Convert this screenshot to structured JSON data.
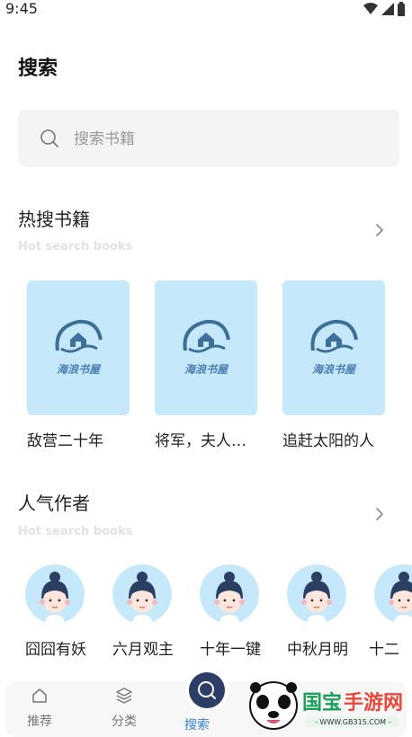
{
  "status": {
    "time": "9:45"
  },
  "page": {
    "title": "搜索"
  },
  "search": {
    "placeholder": "搜索书籍"
  },
  "hot_books": {
    "title": "热搜书籍",
    "subtitle": "Hot search books",
    "cover_logo_text": "海浪书屋",
    "books": [
      {
        "title": "敌营二十年"
      },
      {
        "title": "将军，夫人…"
      },
      {
        "title": "追赶太阳的人"
      }
    ]
  },
  "popular_authors": {
    "title": "人气作者",
    "subtitle": "Hot search books",
    "authors": [
      {
        "name": "囧囧有妖"
      },
      {
        "name": "六月观主"
      },
      {
        "name": "十年一键"
      },
      {
        "name": "中秋月明"
      },
      {
        "name": "十二"
      }
    ]
  },
  "tabs": [
    {
      "label": "推荐",
      "icon": "home-icon",
      "active": false
    },
    {
      "label": "分类",
      "icon": "layers-icon",
      "active": false
    },
    {
      "label": "搜索",
      "icon": "search-icon",
      "active": true
    }
  ],
  "watermark": {
    "brand": "国宝手游网",
    "url": "WWW.GB315.COM"
  },
  "colors": {
    "accent": "#3a7bd5",
    "cover_bg": "#c6e8fb",
    "search_bg": "#f4f4f4"
  }
}
